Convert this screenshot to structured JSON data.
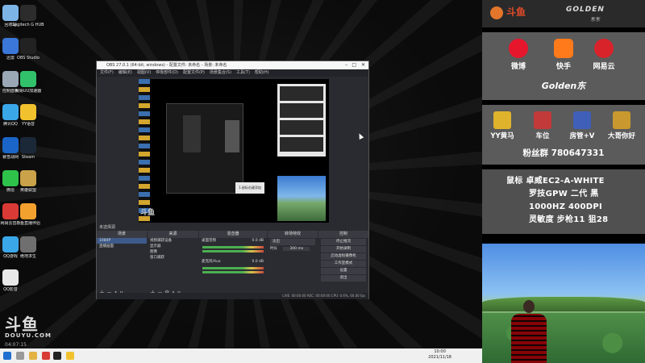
{
  "desktop": {
    "icons": [
      {
        "label": "回收站",
        "color": "#7db4e6"
      },
      {
        "label": "Logitech G HUB",
        "color": "#2c2c2c"
      },
      {
        "label": "迅雷",
        "color": "#3a77d8"
      },
      {
        "label": "OBS Studio",
        "color": "#222222"
      },
      {
        "label": "控制面板",
        "color": "#9aa7b5"
      },
      {
        "label": "网易UU加速器",
        "color": "#31c16a"
      },
      {
        "label": "腾讯QQ",
        "color": "#3aa7e8"
      },
      {
        "label": "YY语音",
        "color": "#f2c12e"
      },
      {
        "label": "暴雪战网",
        "color": "#1a65c7"
      },
      {
        "label": "Steam",
        "color": "#1b2838"
      },
      {
        "label": "微信",
        "color": "#2ec24b"
      },
      {
        "label": "英雄联盟",
        "color": "#c9a24a"
      },
      {
        "label": "网易云音乐",
        "color": "#d93a35"
      },
      {
        "label": "斗鱼直播伴侣",
        "color": "#f2a12e"
      },
      {
        "label": "QQ游戏",
        "color": "#3aa7e8"
      },
      {
        "label": "绝地求生",
        "color": "#6f6f6f"
      },
      {
        "label": "QQ影音",
        "color": "#e8e8e8"
      }
    ],
    "watermark": {
      "mark": "斗鱼",
      "text": "DOUYU.COM",
      "time": "04:07:15"
    },
    "taskbar": {
      "time": "10:00",
      "date": "2021/11/18"
    }
  },
  "obs": {
    "title": "OBS 27.0.1 (64-bit, windows) - 配置文件: 未命名 - 场景: 未命名",
    "menu": [
      "文件(F)",
      "编辑(E)",
      "视图(V)",
      "停靠部件(D)",
      "配置文件(P)",
      "场景集合(S)",
      "工具(T)",
      "帮助(H)"
    ],
    "tooltip": "1.鼠标右键添加",
    "preview_logo": "斗鱼",
    "scene_label": "未选择源",
    "docks": {
      "scenes": {
        "title": "场景",
        "items": [
          "1080P",
          "直播画面"
        ]
      },
      "sources": {
        "title": "来源",
        "items": [
          "视频捕获设备",
          "显示器",
          "图像",
          "窗口捕获"
        ]
      },
      "mixer": {
        "title": "混音器",
        "items": [
          "桌面音频",
          "麦克风/Aux"
        ],
        "levels": [
          "0.0 dB",
          "0.0 dB"
        ]
      },
      "transitions": {
        "title": "转场特效",
        "type": "淡出",
        "duration_label": "时长",
        "duration": "300 ms"
      },
      "controls": {
        "title": "控制",
        "buttons": [
          "停止推流",
          "开始录制",
          "启动虚拟摄像机",
          "工作室模式",
          "设置",
          "退出"
        ]
      }
    },
    "status": "LIVE: 00:00:00   REC: 00:00:00   CPU: 0.6%, 60.00 fps"
  },
  "overlay": {
    "brand": {
      "cn": "斗鱼",
      "en": "GOLDEN",
      "sub": "东东"
    },
    "social": [
      {
        "name": "微博",
        "color": "#e6162d"
      },
      {
        "name": "快手",
        "color": "#ff7a1a"
      },
      {
        "name": "网易云",
        "color": "#d8232a"
      }
    ],
    "handle": "Golden东",
    "gifts": [
      {
        "name": "YY黄马",
        "color": "#e0b32c"
      },
      {
        "name": "车位",
        "color": "#c23a3a"
      },
      {
        "name": "房管+V",
        "color": "#3f5fb8"
      },
      {
        "name": "大哥你好",
        "color": "#c9982f"
      }
    ],
    "fan_group": "粉丝群 780647331",
    "gear": [
      "鼠标 卓威EC2-A-WHITE",
      "罗技GPW 二代 黑",
      "1000HZ 400DPI",
      "灵敏度 步枪11 狙28"
    ]
  }
}
